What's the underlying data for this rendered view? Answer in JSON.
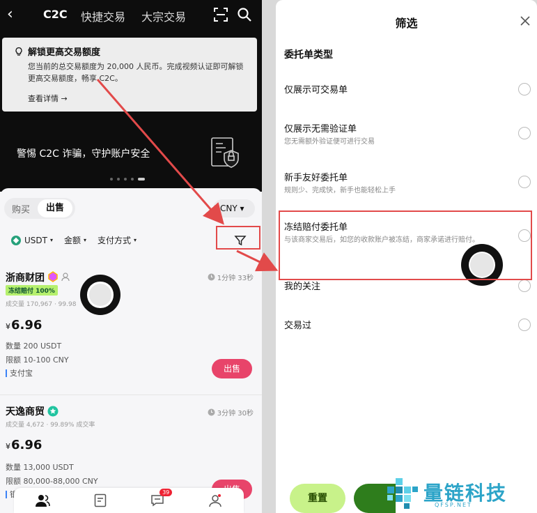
{
  "left": {
    "nav": {
      "back": "‹",
      "tabs": [
        "C2C",
        "快捷交易",
        "大宗交易"
      ]
    },
    "notice": {
      "title": "解锁更高交易额度",
      "body": "您当前的总交易额度为 20,000 人民币。完成视频认证即可解锁更高交易额度，畅享 C2C。",
      "link": "查看详情 →"
    },
    "banner": {
      "text": "警惕 C2C 诈骗，守护账户安全"
    },
    "segment": {
      "buy": "购买",
      "sell": "出售"
    },
    "currency": "CNY ▾",
    "filters": {
      "asset": "USDT",
      "amount": "金额",
      "payment": "支付方式",
      "caret": "▾"
    },
    "listings": [
      {
        "merchant": "浙商财团",
        "badge": "冻结赔付 100%",
        "stats": "成交量 170,967 · 99.98",
        "time": "1分钟 33秒",
        "currency_symbol": "¥",
        "price": "6.96",
        "quantity": "数量 200 USDT",
        "limit": "限额 10-100 CNY",
        "payment": "支付宝",
        "action": "出售"
      },
      {
        "merchant": "天逸商贸",
        "stats": "成交量 4,672 · 99.89% 成交率",
        "time": "3分钟 30秒",
        "currency_symbol": "¥",
        "price": "6.96",
        "quantity": "数量 13,000 USDT",
        "limit": "限额 80,000-88,000 CNY",
        "payment": "银",
        "action": "出售"
      }
    ],
    "tabbar": {
      "notification_count": "39"
    }
  },
  "right": {
    "title": "筛选",
    "section": "委托单类型",
    "options": [
      {
        "title": "仅展示可交易单",
        "desc": ""
      },
      {
        "title": "仅展示无需验证单",
        "desc": "您无需额外验证便可进行交易"
      },
      {
        "title": "新手友好委托单",
        "desc": "规则少、完成快，新手也能轻松上手"
      },
      {
        "title": "冻结赔付委托单",
        "desc": "与该商家交易后，如您的收款账户被冻结，商家承诺进行赔付。"
      },
      {
        "title": "我的关注",
        "desc": ""
      },
      {
        "title": "交易过",
        "desc": ""
      }
    ],
    "buttons": {
      "reset": "重置"
    }
  },
  "watermark": {
    "text": "量链科技",
    "sub": "QFSP.NET"
  },
  "colors": {
    "accent_red": "#e8446a",
    "annotation_red": "#e24a4a",
    "badge_green": "#b6f06e",
    "reset_green": "#c8f28a",
    "confirm_green": "#2e7d1c",
    "watermark_blue": "#2ca4c8"
  },
  "icons": {
    "back": "chevron-left-icon",
    "scan": "scan-icon",
    "search": "search-icon",
    "bulb": "lightbulb-icon",
    "filter": "funnel-icon",
    "close": "close-icon",
    "clock": "clock-icon",
    "merchant_badge": "diamond-badge-icon",
    "verified": "verified-badge-icon"
  }
}
